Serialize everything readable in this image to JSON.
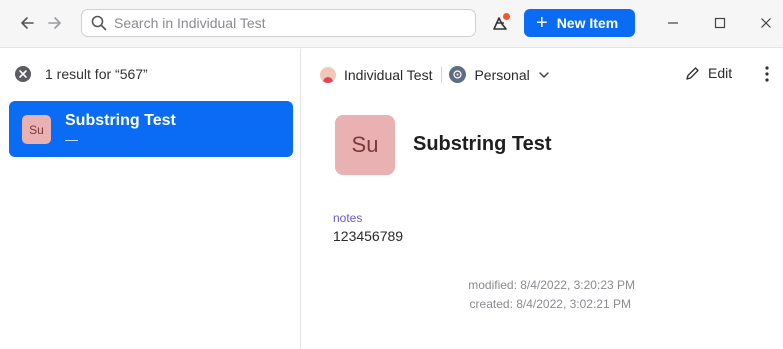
{
  "search": {
    "placeholder": "Search in Individual Test"
  },
  "toolbar": {
    "new_item_label": "New Item"
  },
  "list": {
    "results_label": "1 result for “567”",
    "items": [
      {
        "avatar": "Su",
        "title": "Substring Test",
        "subtitle": "—"
      }
    ]
  },
  "detail": {
    "vault_owner": "Individual Test",
    "vault_name": "Personal",
    "edit_label": "Edit",
    "avatar": "Su",
    "title": "Substring Test",
    "fields": [
      {
        "label": "notes",
        "value": "123456789"
      }
    ],
    "modified": "modified: 8/4/2022, 3:20:23 PM",
    "created": "created: 8/4/2022, 3:02:21 PM"
  },
  "icons": {
    "back": "arrow-left-icon",
    "forward": "arrow-right-icon",
    "search": "search-icon",
    "watchtower": "watchtower-icon",
    "plus": "plus-icon",
    "minimize": "minimize-icon",
    "maximize": "maximize-icon",
    "close": "close-icon",
    "clear": "clear-search-icon",
    "chevron": "chevron-down-icon",
    "edit": "pencil-icon",
    "more": "more-vertical-icon"
  },
  "colors": {
    "accent": "#0a6cf5",
    "avatar_bg": "#e9b1b1",
    "field_label": "#6a5acd",
    "notification_dot": "#f05a2a"
  }
}
